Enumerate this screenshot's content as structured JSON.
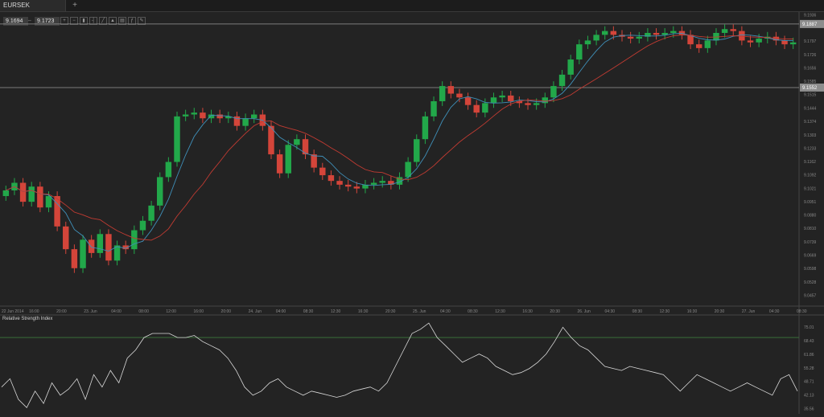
{
  "tab": {
    "symbol": "EURSEK",
    "add_label": "+"
  },
  "quote": {
    "bid": "9.1694",
    "separator": "⇔",
    "ask": "9.1723"
  },
  "toolbar": {
    "tools": [
      "zoom-in-icon",
      "zoom-out-icon",
      "candles-icon",
      "bars-icon",
      "line-icon",
      "area-icon",
      "template-icon",
      "indicator-icon",
      "draw-icon"
    ]
  },
  "colors": {
    "up": "#22a84a",
    "down": "#d4453a",
    "ma_fast": "#3f8fb8",
    "ma_slow": "#c23b32",
    "rsi_line": "#d9d9d9",
    "level_line": "#9a9a9a",
    "rsi_upper": "#3c7a3c",
    "rsi_lower": "#8a2b2b"
  },
  "chart_data": {
    "type": "candlestick",
    "symbol": "EURSEK",
    "y_ticks": [
      "9.1936",
      "9.1887",
      "9.1797",
      "9.1726",
      "9.1656",
      "9.1585",
      "9.1515",
      "9.1444",
      "9.1374",
      "9.1303",
      "9.1233",
      "9.1162",
      "9.1092",
      "9.1021",
      "9.0951",
      "9.0880",
      "9.0810",
      "9.0739",
      "9.0669",
      "9.0598",
      "9.0528",
      "9.0457"
    ],
    "ylim": [
      9.04,
      9.195
    ],
    "level_lines": [
      "9.1887",
      "9.1552"
    ],
    "x_ticks": [
      "22 Jun 2014",
      "16:00",
      "20:00",
      "23. Jun",
      "04:00",
      "08:00",
      "12:00",
      "16:00",
      "20:00",
      "24. Jun",
      "04:00",
      "08:30",
      "12:30",
      "16:30",
      "20:30",
      "25. Jun",
      "04:30",
      "08:30",
      "12:30",
      "16:30",
      "20:30",
      "26. Jun",
      "04:30",
      "08:30",
      "12:30",
      "16:30",
      "20:30",
      "27. Jun",
      "04:30",
      "08:30"
    ],
    "close": [
      9.101,
      9.105,
      9.095,
      9.103,
      9.092,
      9.098,
      9.082,
      9.07,
      9.06,
      9.075,
      9.068,
      9.078,
      9.064,
      9.072,
      9.07,
      9.08,
      9.085,
      9.093,
      9.108,
      9.116,
      9.14,
      9.141,
      9.142,
      9.139,
      9.141,
      9.139,
      9.14,
      9.135,
      9.139,
      9.141,
      9.135,
      9.12,
      9.11,
      9.125,
      9.128,
      9.12,
      9.113,
      9.109,
      9.106,
      9.104,
      9.103,
      9.102,
      9.104,
      9.105,
      9.106,
      9.104,
      9.108,
      9.116,
      9.128,
      9.14,
      9.148,
      9.156,
      9.152,
      9.15,
      9.146,
      9.142,
      9.147,
      9.15,
      9.151,
      9.148,
      9.147,
      9.146,
      9.147,
      9.15,
      9.156,
      9.162,
      9.17,
      9.178,
      9.18,
      9.183,
      9.185,
      9.183,
      9.182,
      9.181,
      9.182,
      9.184,
      9.183,
      9.184,
      9.185,
      9.183,
      9.178,
      9.176,
      9.18,
      9.184,
      9.186,
      9.185,
      9.18,
      9.179,
      9.181,
      9.182,
      9.18,
      9.178,
      9.179
    ],
    "indicator": {
      "name": "Relative Strength Index",
      "y_ticks": [
        "75.01",
        "68.43",
        "61.86",
        "55.28",
        "48.71",
        "42.13",
        "35.56"
      ],
      "ylim": [
        33,
        79
      ],
      "levels": [
        70,
        30
      ],
      "values": [
        46,
        50,
        40,
        36,
        44,
        38,
        48,
        42,
        45,
        50,
        40,
        52,
        46,
        54,
        48,
        60,
        64,
        70,
        72,
        72,
        72,
        70,
        70,
        71,
        68,
        66,
        64,
        60,
        54,
        46,
        42,
        44,
        48,
        50,
        46,
        44,
        42,
        44,
        43,
        42,
        41,
        42,
        44,
        45,
        46,
        44,
        48,
        56,
        64,
        72,
        74,
        77,
        70,
        66,
        62,
        58,
        60,
        62,
        60,
        56,
        54,
        52,
        53,
        55,
        58,
        62,
        68,
        75,
        70,
        66,
        64,
        60,
        56,
        55,
        54,
        56,
        55,
        54,
        53,
        52,
        48,
        44,
        48,
        52,
        50,
        48,
        46,
        44,
        46,
        48,
        46,
        44,
        42,
        50,
        52,
        44
      ]
    }
  }
}
